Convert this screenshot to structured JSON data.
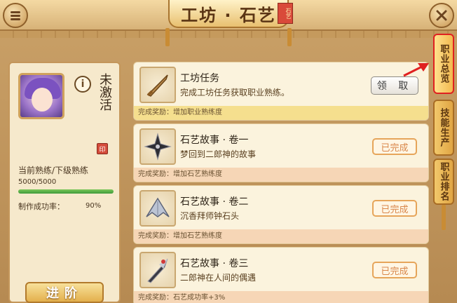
{
  "header": {
    "title": "工坊 · 石艺",
    "title_tag": "石艺"
  },
  "icons": {
    "menu": "menu-icon",
    "close": "close-icon",
    "info": "info-icon",
    "stamp": "stamp-icon"
  },
  "profile": {
    "status": "未激活",
    "proficiency_label": "当前熟练/下级熟练",
    "proficiency_value": "5000/5000",
    "proficiency_progress": 1.0,
    "success_rate_label": "制作成功率：",
    "success_rate_value": "90%",
    "advance_label": "进阶"
  },
  "tasks": [
    {
      "title": "工坊任务",
      "desc": "完成工坊任务获取职业熟练。",
      "reward": "完成奖励：增加职业熟练度",
      "action": "领 取",
      "state": "claimable"
    },
    {
      "title": "石艺故事 · 卷一",
      "desc": "梦回到二郎神的故事",
      "reward": "完成奖励：增加石艺熟练度",
      "action": "已完成",
      "state": "done"
    },
    {
      "title": "石艺故事 · 卷二",
      "desc": "沉香拜师钟石头",
      "reward": "完成奖励：增加石艺熟练度",
      "action": "已完成",
      "state": "done"
    },
    {
      "title": "石艺故事 · 卷三",
      "desc": "二郎神在人间的偶遇",
      "reward": "完成奖励：石艺成功率+3%",
      "action": "已完成",
      "state": "done"
    }
  ],
  "tabs": [
    {
      "label": "职业总览",
      "active": true
    },
    {
      "label": "技能生产",
      "active": false
    },
    {
      "label": "职业排名",
      "active": false
    }
  ],
  "colors": {
    "accent_red": "#e02020",
    "done_orange": "#d9874a"
  }
}
